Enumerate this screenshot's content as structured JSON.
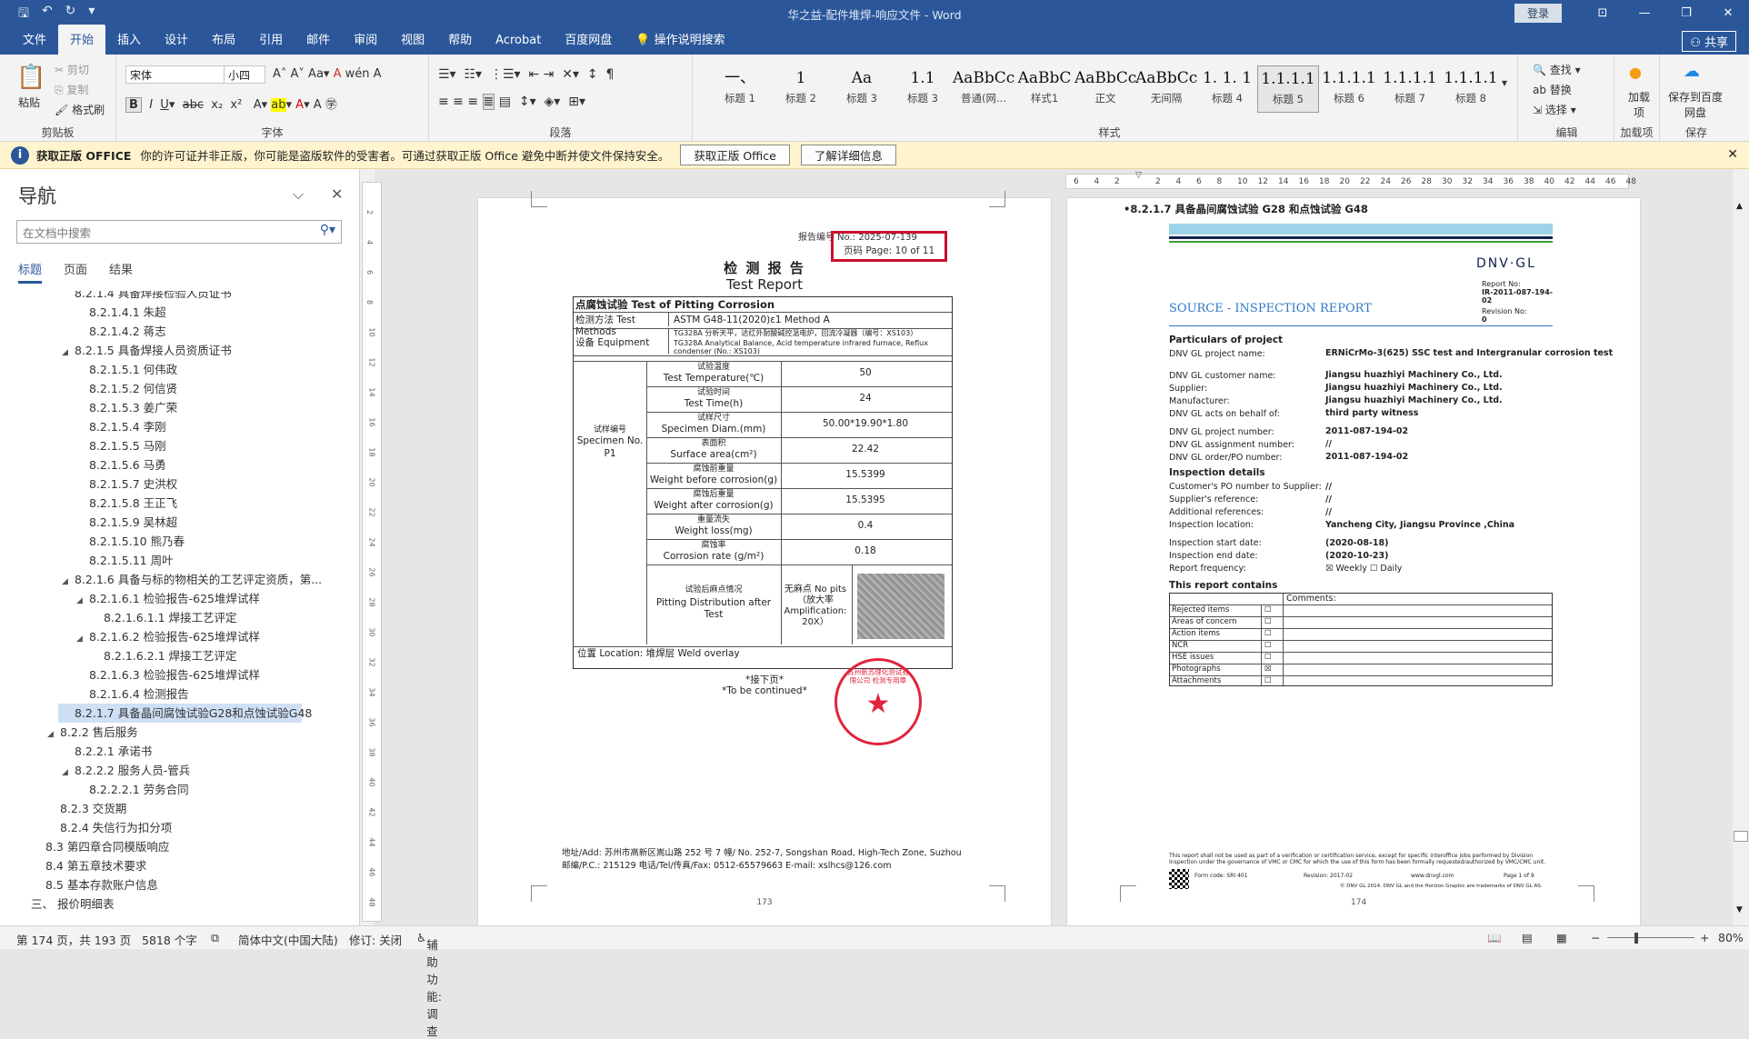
{
  "app": {
    "title": "华之益-配件堆焊-响应文件 - Word",
    "login": "登录",
    "share": "共享"
  },
  "tabs": [
    "文件",
    "开始",
    "插入",
    "设计",
    "布局",
    "引用",
    "邮件",
    "审阅",
    "视图",
    "帮助",
    "Acrobat",
    "百度网盘",
    "操作说明搜索"
  ],
  "ribbon": {
    "clipboard": {
      "paste": "粘贴",
      "cut": "剪切",
      "copy": "复制",
      "painter": "格式刷",
      "label": "剪贴板"
    },
    "font": {
      "name": "宋体",
      "size": "小四",
      "label": "字体"
    },
    "paragraph": {
      "label": "段落"
    },
    "styles": {
      "label": "样式",
      "items": [
        {
          "p": "一、",
          "l": "标题 1"
        },
        {
          "p": "1",
          "l": "标题 2"
        },
        {
          "p": "Aa",
          "l": "标题 3"
        },
        {
          "p": "1.1",
          "l": "标题 3"
        },
        {
          "p": "AaBbCcI",
          "l": "普通(网..."
        },
        {
          "p": "AaBbC",
          "l": "样式1"
        },
        {
          "p": "AaBbCcDdI",
          "l": "正文"
        },
        {
          "p": "AaBbCcDdI",
          "l": "无间隔"
        },
        {
          "p": "1. 1. 1",
          "l": "标题 4"
        },
        {
          "p": "1.1.1.1",
          "l": "标题 5"
        },
        {
          "p": "1.1.1.1",
          "l": "标题 6"
        },
        {
          "p": "1.1.1.1",
          "l": "标题 7"
        },
        {
          "p": "1.1.1.1",
          "l": "标题 8"
        }
      ]
    },
    "edit": {
      "find": "查找",
      "replace": "替换",
      "select": "选择",
      "label": "编辑"
    },
    "addin": {
      "btn": "加载项",
      "label": "加载项"
    },
    "save": {
      "btn": "保存到百度网盘",
      "label": "保存"
    }
  },
  "infobar": {
    "title": "获取正版 OFFICE",
    "msg": "你的许可证并非正版，你可能是盗版软件的受害者。可通过获取正版 Office 避免中断并使文件保持安全。",
    "btn1": "获取正版 Office",
    "btn2": "了解详细信息"
  },
  "nav": {
    "title": "导航",
    "search_ph": "在文档中搜索",
    "tabs": [
      "标题",
      "页面",
      "结果"
    ],
    "items": [
      {
        "t": "8.2.1.4 具备焊接检验人员证书",
        "lv": 4,
        "tri": ""
      },
      {
        "t": "8.2.1.4.1 朱超",
        "lv": 5,
        "tri": ""
      },
      {
        "t": "8.2.1.4.2 蒋志",
        "lv": 5,
        "tri": ""
      },
      {
        "t": "8.2.1.5 具备焊接人员资质证书",
        "lv": 4,
        "tri": "◢"
      },
      {
        "t": "8.2.1.5.1 何伟政",
        "lv": 5,
        "tri": ""
      },
      {
        "t": "8.2.1.5.2 何信贤",
        "lv": 5,
        "tri": ""
      },
      {
        "t": "8.2.1.5.3 姜广荣",
        "lv": 5,
        "tri": ""
      },
      {
        "t": "8.2.1.5.4 李刚",
        "lv": 5,
        "tri": ""
      },
      {
        "t": "8.2.1.5.5 马刚",
        "lv": 5,
        "tri": ""
      },
      {
        "t": "8.2.1.5.6 马勇",
        "lv": 5,
        "tri": ""
      },
      {
        "t": "8.2.1.5.7 史洪权",
        "lv": 5,
        "tri": ""
      },
      {
        "t": "8.2.1.5.8 王正飞",
        "lv": 5,
        "tri": ""
      },
      {
        "t": "8.2.1.5.9 吴林超",
        "lv": 5,
        "tri": ""
      },
      {
        "t": "8.2.1.5.10 熊乃春",
        "lv": 5,
        "tri": ""
      },
      {
        "t": "8.2.1.5.11 周叶",
        "lv": 5,
        "tri": ""
      },
      {
        "t": "8.2.1.6 具备与标的物相关的工艺评定资质，第...",
        "lv": 4,
        "tri": "◢"
      },
      {
        "t": "8.2.1.6.1 检验报告-625堆焊试样",
        "lv": 5,
        "tri": "◢"
      },
      {
        "t": "8.2.1.6.1.1 焊接工艺评定",
        "lv": 6,
        "tri": ""
      },
      {
        "t": "8.2.1.6.2 检验报告-625堆焊试样",
        "lv": 5,
        "tri": "◢"
      },
      {
        "t": "8.2.1.6.2.1 焊接工艺评定",
        "lv": 6,
        "tri": ""
      },
      {
        "t": "8.2.1.6.3 检验报告-625堆焊试样",
        "lv": 5,
        "tri": ""
      },
      {
        "t": "8.2.1.6.4 检测报告",
        "lv": 5,
        "tri": ""
      },
      {
        "t": "8.2.1.7 具备晶间腐蚀试验G28和点蚀试验G48",
        "lv": 4,
        "tri": "",
        "sel": true
      },
      {
        "t": "8.2.2 售后服务",
        "lv": 3,
        "tri": "◢"
      },
      {
        "t": "8.2.2.1 承诺书",
        "lv": 4,
        "tri": ""
      },
      {
        "t": "8.2.2.2 服务人员-管兵",
        "lv": 4,
        "tri": "◢"
      },
      {
        "t": "8.2.2.2.1 劳务合同",
        "lv": 5,
        "tri": ""
      },
      {
        "t": "8.2.3 交货期",
        "lv": 3,
        "tri": ""
      },
      {
        "t": "8.2.4 失信行为扣分项",
        "lv": 3,
        "tri": ""
      },
      {
        "t": "8.3 第四章合同模版响应",
        "lv": 2,
        "tri": ""
      },
      {
        "t": "8.4 第五章技术要求",
        "lv": 2,
        "tri": ""
      },
      {
        "t": "8.5 基本存款账户信息",
        "lv": 2,
        "tri": ""
      },
      {
        "t": "三、 报价明细表",
        "lv": 1,
        "tri": ""
      }
    ]
  },
  "report": {
    "no": "报告编号 No.: 2025-07-139",
    "pg_cn": "页码",
    "pg": "Page: 10 of 11",
    "title_cn": "检 测 报 告",
    "title_en": "Test Report",
    "sec": "点腐蚀试验 Test of Pitting Corrosion",
    "method_l": "检测方法 Test Methods",
    "method_v": "ASTM G48-11(2020)ε1 Method A",
    "eq_l": "设备 Equipment",
    "eq_v1": "TG328A 分析天平，达红外耐酸碱控温电炉，回流冷凝器（编号：XS103）",
    "eq_v2": "TG328A Analytical Balance, Acid temperature infrared furnace, Reflux condenser (No.: XS103)",
    "specimen_cn": "试样编号",
    "specimen_en": "Specimen No.",
    "specimen_v": "P1",
    "rows": [
      {
        "cn": "试验温度",
        "en": "Test Temperature(℃)",
        "v": "50"
      },
      {
        "cn": "试验时间",
        "en": "Test Time(h)",
        "v": "24"
      },
      {
        "cn": "试样尺寸",
        "en": "Specimen Diam.(mm)",
        "v": "50.00*19.90*1.80"
      },
      {
        "cn": "表面积",
        "en": "Surface area(cm²)",
        "v": "22.42"
      },
      {
        "cn": "腐蚀前重量",
        "en": "Weight before corrosion(g)",
        "v": "15.5399"
      },
      {
        "cn": "腐蚀后重量",
        "en": "Weight after corrosion(g)",
        "v": "15.5395"
      },
      {
        "cn": "重量流失",
        "en": "Weight loss(mg)",
        "v": "0.4"
      },
      {
        "cn": "腐蚀率",
        "en": "Corrosion rate (g/m²)",
        "v": "0.18"
      }
    ],
    "pit_cn": "试验后麻点情况",
    "pit_en": "Pitting Distribution after Test",
    "pit_v": "无麻点 No pits（放大率 Amplification: 20X）",
    "loc": "位置 Location: 堆焊层 Weld overlay",
    "cont_cn": "*接下页*",
    "cont_en": "*To be continued*",
    "addr": "地址/Add: 苏州市高新区嵩山路 252 号 7 幢/ No. 252-7, Songshan Road, High-Tech Zone, Suzhou",
    "post": "邮编/P.C.: 215129     电话/Tel/传真/Fax: 0512-65579663     E-mail: xslhcs@126.com",
    "stamp": "苏州新苏理化测试有限公司 检测专用章",
    "pnum": "173"
  },
  "dnv": {
    "heading": "•8.2.1.7 具备晶间腐蚀试验 G28 和点蚀试验 G48",
    "logo": "DNV·GL",
    "src": "SOURCE - INSPECTION REPORT",
    "rno_l": "Report No:",
    "rno": "IR-2011-087-194-02",
    "rev_l": "Revision No:",
    "rev": "0",
    "part_h": "Particulars of project",
    "part": [
      {
        "k": "DNV GL project name:",
        "v": "ERNiCrMo-3(625) SSC test and Intergranular corrosion test"
      },
      {
        "k": "DNV GL customer name:",
        "v": "Jiangsu huazhiyi Machinery Co., Ltd."
      },
      {
        "k": "Supplier:",
        "v": "Jiangsu huazhiyi Machinery Co., Ltd."
      },
      {
        "k": "Manufacturer:",
        "v": "Jiangsu huazhiyi Machinery Co., Ltd."
      },
      {
        "k": "DNV GL acts on behalf of:",
        "v": "third party witness"
      },
      {
        "k": "DNV GL project number:",
        "v": "2011-087-194-02"
      },
      {
        "k": "DNV GL assignment number:",
        "v": "//"
      },
      {
        "k": "DNV GL order/PO number:",
        "v": "2011-087-194-02"
      }
    ],
    "insp_h": "Inspection details",
    "insp": [
      {
        "k": "Customer's PO number to Supplier:",
        "v": "//"
      },
      {
        "k": "Supplier's reference:",
        "v": "//"
      },
      {
        "k": "Additional references:",
        "v": "//"
      },
      {
        "k": "Inspection location:",
        "v": "Yancheng City, Jiangsu Province ,China"
      },
      {
        "k": "Inspection start date:",
        "v": "(2020-08-18)"
      },
      {
        "k": "Inspection end date:",
        "v": "(2020-10-23)"
      },
      {
        "k": "Report frequency:",
        "v": "☒ Weekly  ☐ Daily"
      }
    ],
    "contains_h": "This report contains",
    "comments": "Comments:",
    "contains": [
      {
        "k": "Rejected items",
        "c": "☐"
      },
      {
        "k": "Areas of concern",
        "c": "☐"
      },
      {
        "k": "Action items",
        "c": "☐"
      },
      {
        "k": "NCR",
        "c": "☐"
      },
      {
        "k": "HSE issues",
        "c": "☐"
      },
      {
        "k": "Photographs",
        "c": "☒"
      },
      {
        "k": "Attachments",
        "c": "☐"
      }
    ],
    "foot1": "This report shall not be used as part of a verification or certification service, except for specific interoffice jobs performed by Division Inspection under the governance of VMC or CMC for which the use of this form has been formally requested/authorized by VMC/CMC unit.",
    "form": "Form code: SRI 401",
    "revision": "Revision: 2017-02",
    "site": "www.dnvgl.com",
    "pageof": "Page 1 of 9",
    "copy": "© DNV GL 2014. DNV GL and the Horizon Graphic are trademarks of DNV GL AS.",
    "pnum": "174"
  },
  "ruler": [
    "6",
    "4",
    "2",
    "",
    "2",
    "4",
    "6",
    "8",
    "10",
    "12",
    "14",
    "16",
    "18",
    "20",
    "22",
    "24",
    "26",
    "28",
    "30",
    "32",
    "34",
    "36",
    "38",
    "40",
    "42",
    "44",
    "46",
    "48"
  ],
  "vruler": [
    "2",
    "4",
    "6",
    "8",
    "10",
    "12",
    "14",
    "16",
    "18",
    "20",
    "22",
    "24",
    "26",
    "28",
    "30",
    "32",
    "34",
    "36",
    "38",
    "40",
    "42",
    "44",
    "46",
    "48"
  ],
  "status": {
    "page": "第 174 页，共 193 页",
    "words": "5818 个字",
    "lang": "简体中文(中国大陆)",
    "track": "修订: 关闭",
    "access": "辅助功能: 调查",
    "zoom": "80%"
  },
  "colors": {
    "accent": "#2b579a",
    "stamp": "#e0243b",
    "highlight": "#c8102e"
  }
}
